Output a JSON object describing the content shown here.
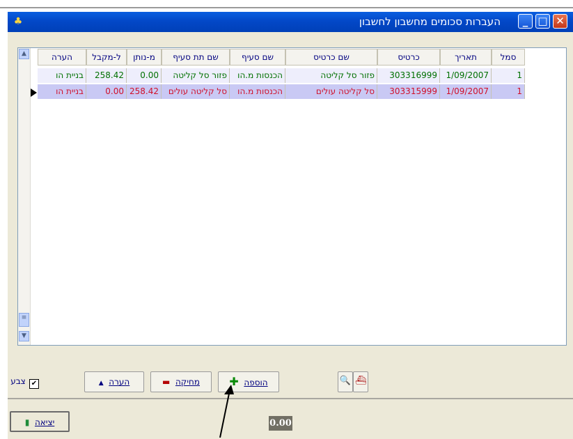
{
  "window": {
    "title": "העברות סכומים מחשבון לחשבון"
  },
  "columns": [
    "סמל",
    "תאריך",
    "כרטיס",
    "שם כרטיס",
    "שם סעיף",
    "שם תת סעיף",
    "מ-נותן",
    "ל-מקבל",
    "הערה"
  ],
  "rows": [
    [
      "1",
      "1/09/2007",
      "303316999",
      "פזור סל קליטה",
      "הכנסות מ.הו",
      "פזור סל קליטה",
      "0.00",
      "258.42",
      "בניית הו"
    ],
    [
      "1",
      "1/09/2007",
      "303315999",
      "סל קליטה עולים",
      "הכנסות מ.הו",
      "סל קליטה עולים",
      "258.42",
      "0.00",
      "בניית הו"
    ]
  ],
  "buttons": {
    "add": "הוספה",
    "delete": "מחיקה",
    "note": "הערה",
    "exit": "יציאה"
  },
  "color_checkbox_label": "צבע",
  "color_checkbox_checked": true,
  "total": "0.00",
  "colors": {
    "row1_text": "#007000",
    "row2_text": "#d0102a",
    "header_text": "#000080"
  }
}
